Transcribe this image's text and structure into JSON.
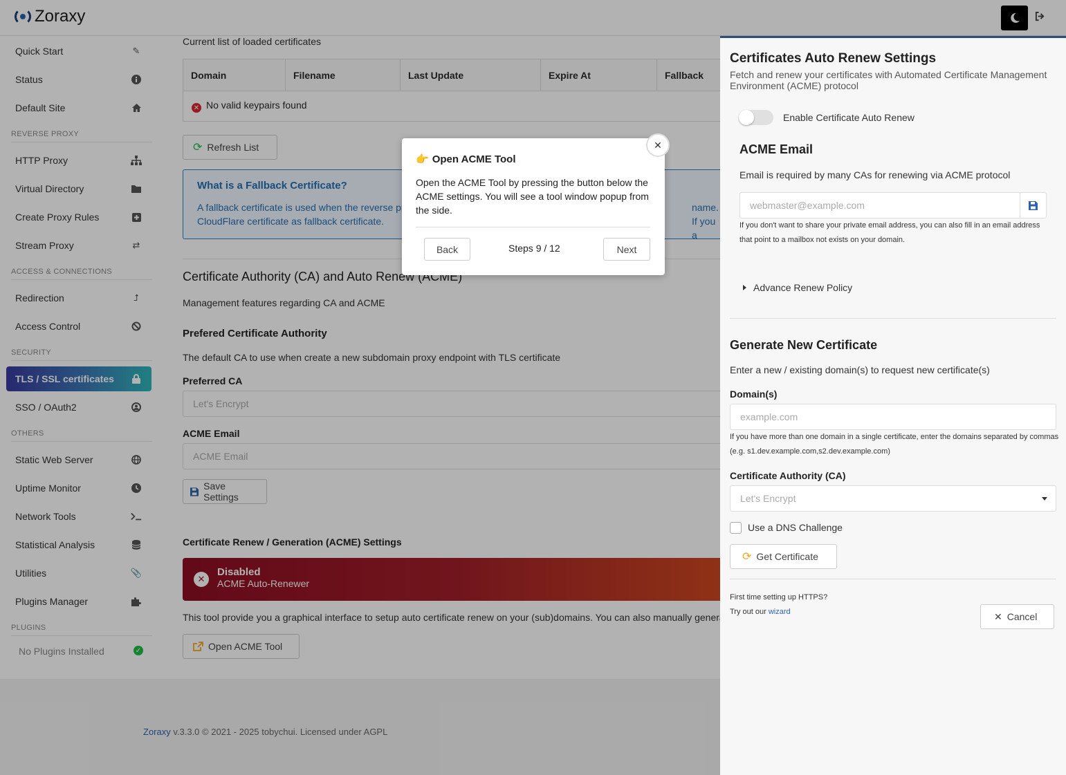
{
  "app": {
    "title": "Zoraxy"
  },
  "header": {
    "theme_icon": "moon-icon",
    "logout_icon": "logout-icon"
  },
  "sidebar": {
    "items": [
      {
        "label": "Quick Start",
        "icon": "magic-wand-icon"
      },
      {
        "label": "Status",
        "icon": "info-icon"
      },
      {
        "label": "Default Site",
        "icon": "home-icon"
      },
      {
        "label": "HTTP Proxy",
        "icon": "sitemap-icon"
      },
      {
        "label": "Virtual Directory",
        "icon": "folder-icon"
      },
      {
        "label": "Create Proxy Rules",
        "icon": "plus-square-icon"
      },
      {
        "label": "Stream Proxy",
        "icon": "exchange-icon"
      },
      {
        "label": "Redirection",
        "icon": "level-up-icon"
      },
      {
        "label": "Access Control",
        "icon": "ban-icon"
      },
      {
        "label": "TLS / SSL certificates",
        "icon": "lock-icon"
      },
      {
        "label": "SSO / OAuth2",
        "icon": "user-circle-icon"
      },
      {
        "label": "Static Web Server",
        "icon": "globe-icon"
      },
      {
        "label": "Uptime Monitor",
        "icon": "clock-icon"
      },
      {
        "label": "Network Tools",
        "icon": "terminal-icon"
      },
      {
        "label": "Statistical Analysis",
        "icon": "database-icon"
      },
      {
        "label": "Utilities",
        "icon": "paperclip-icon"
      },
      {
        "label": "Plugins Manager",
        "icon": "puzzle-icon"
      }
    ],
    "sections": [
      "REVERSE PROXY",
      "ACCESS & CONNECTIONS",
      "SECURITY",
      "OTHERS",
      "PLUGINS"
    ],
    "plugins_empty": "No Plugins Installed"
  },
  "main": {
    "loaded_caption": "Current list of loaded certificates",
    "table": {
      "headers": [
        "Domain",
        "Filename",
        "Last Update",
        "Expire At",
        "Fallback"
      ],
      "empty": "No valid keypairs found"
    },
    "refresh_label": "Refresh List",
    "fallback_info": {
      "title": "What is a Fallback Certificate?",
      "line1": "A fallback certificate is used when the reverse pro",
      "line1_tail": "name. If you a",
      "line2": "CloudFlare certificate as fallback certificate."
    },
    "ca_title": "Certificate Authority (CA) and Auto Renew (ACME)",
    "ca_desc": "Management features regarding CA and ACME",
    "pref_title": "Prefered Certificate Authority",
    "pref_desc": "The default CA to use when create a new subdomain proxy endpoint with TLS certificate",
    "preferred_ca_label": "Preferred CA",
    "preferred_ca_value": "Let's Encrypt",
    "acme_email_label": "ACME Email",
    "acme_email_placeholder": "ACME Email",
    "save_label": "Save Settings",
    "renew_title": "Certificate Renew / Generation (ACME) Settings",
    "banner": {
      "status": "Disabled",
      "subtitle": "ACME Auto-Renewer"
    },
    "tool_desc": "This tool provide you a graphical interface to setup auto certificate renew on your (sub)domains. You can also manually generate a",
    "open_acme_label": "Open ACME Tool"
  },
  "footer": {
    "brand": "Zoraxy",
    "text": " v.3.3.0 © 2021 - 2025 tobychui. Licensed under AGPL"
  },
  "panel": {
    "title": "Certificates Auto Renew Settings",
    "subtitle": "Fetch and renew your certificates with Automated Certificate Management Environment (ACME) protocol",
    "enable_label": "Enable Certificate Auto Renew",
    "email_title": "ACME Email",
    "email_desc": "Email is required by many CAs for renewing via ACME protocol",
    "email_placeholder": "webmaster@example.com",
    "email_hint1": "If you don't want to share your private email address, you can also fill in an email address",
    "email_hint2": "that point to a mailbox not exists on your domain.",
    "advance_label": "Advance Renew Policy",
    "gen_title": "Generate New Certificate",
    "gen_desc": "Enter a new / existing domain(s) to request new certificate(s)",
    "domains_label": "Domain(s)",
    "domains_placeholder": "example.com",
    "domains_hint1": "If you have more than one domain in a single certificate, enter the domains separated by commas",
    "domains_hint2": "(e.g. s1.dev.example.com,s2.dev.example.com)",
    "ca_label": "Certificate Authority (CA)",
    "ca_value": "Let's Encrypt",
    "dns_label": "Use a DNS Challenge",
    "get_cert_label": "Get Certificate",
    "first_time": "First time setting up HTTPS?",
    "try_out": "Try out our ",
    "wizard": "wizard",
    "cancel_label": "Cancel"
  },
  "modal": {
    "title": "Open ACME Tool",
    "body": "Open the ACME Tool by pressing the button below the ACME settings. You will see a tool window popup from the side.",
    "back_label": "Back",
    "steps": "Steps 9 / 12",
    "next_label": "Next"
  }
}
